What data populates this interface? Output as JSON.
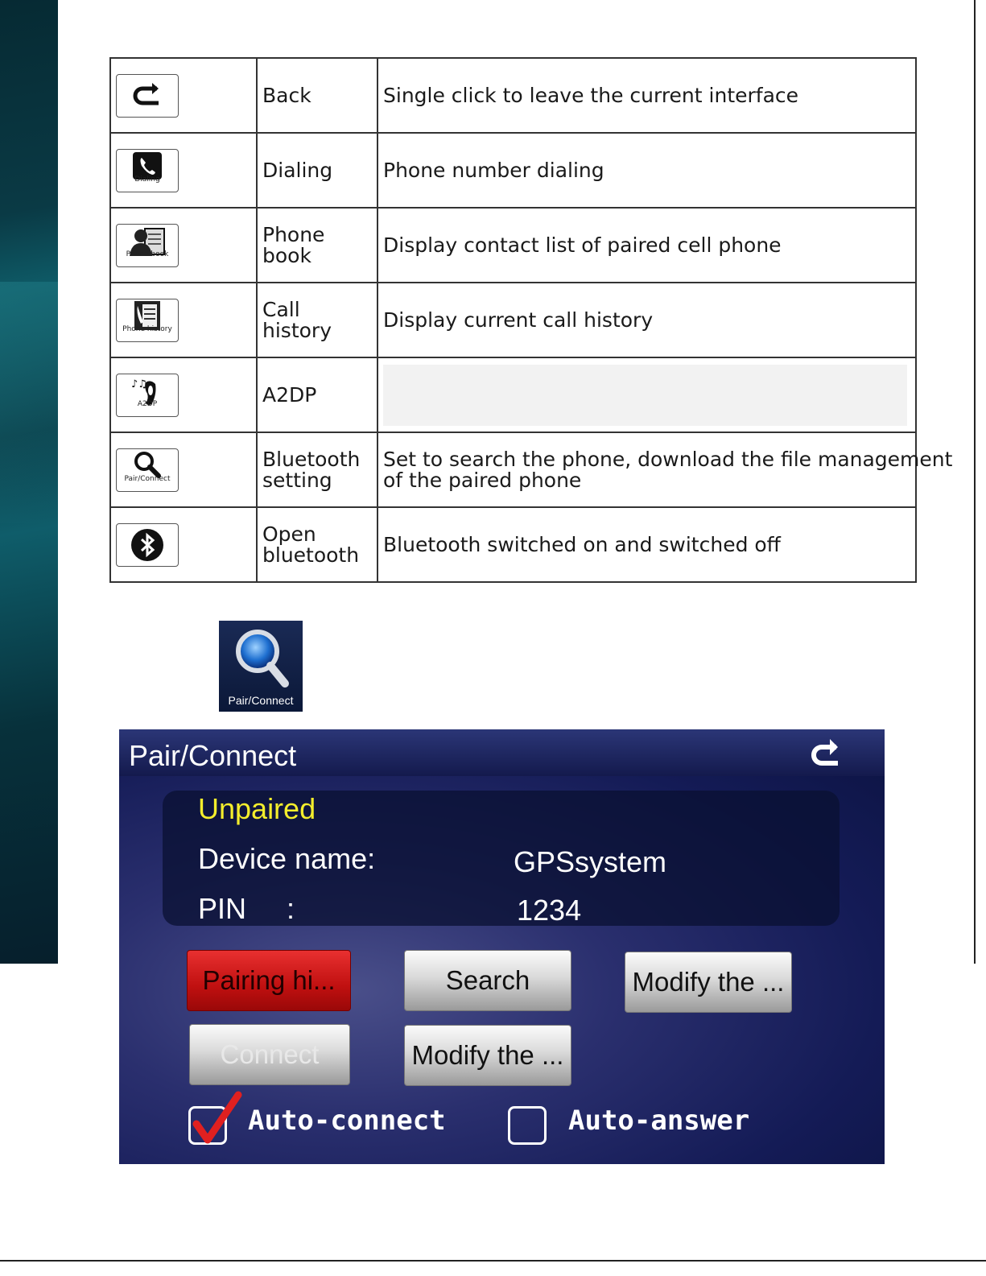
{
  "table": {
    "rows": [
      {
        "icon": "back-arrow-icon",
        "caption": "",
        "name": "Back",
        "desc": "Single click to leave the current interface"
      },
      {
        "icon": "phone-handset-icon",
        "caption": "Dialing",
        "name": "Dialing",
        "desc": "Phone number dialing"
      },
      {
        "icon": "contact-book-icon",
        "caption": "Phone book",
        "name": "Phone book",
        "desc": "Display contact list of paired cell phone"
      },
      {
        "icon": "call-history-icon",
        "caption": "Phone history",
        "name": "Call history",
        "desc": "Display current call history"
      },
      {
        "icon": "music-phone-icon",
        "caption": "A2DP",
        "name": "A2DP",
        "desc": ""
      },
      {
        "icon": "magnifier-icon",
        "caption": "Pair/Connect",
        "name_line1": "Bluetooth",
        "name_line2": "setting",
        "desc_line1": "Set to search the phone, download the file management",
        "desc_line2": "of the paired phone"
      },
      {
        "icon": "bluetooth-icon",
        "caption": "",
        "name_line1": "Open",
        "name_line2": "bluetooth",
        "desc": "Bluetooth switched on and switched off"
      }
    ]
  },
  "pair_icon": {
    "label": "Pair/Connect",
    "icon": "magnifier-icon"
  },
  "screen": {
    "title": "Pair/Connect",
    "status": "Unpaired",
    "device_name_label": "Device name:",
    "device_name_value": "GPSsystem",
    "pin_label": "PIN",
    "pin_colon": ":",
    "pin_value": "1234",
    "buttons": {
      "pairing_history": "Pairing hi...",
      "search": "Search",
      "modify_1": "Modify the ...",
      "connect": "Connect",
      "modify_2": "Modify the ..."
    },
    "auto_connect": {
      "label": "Auto-connect",
      "checked": true
    },
    "auto_answer": {
      "label": "Auto-answer",
      "checked": false
    },
    "colors": {
      "status": "#f4ee2c",
      "pairing_button": "#d01818",
      "check": "#e02020"
    }
  }
}
